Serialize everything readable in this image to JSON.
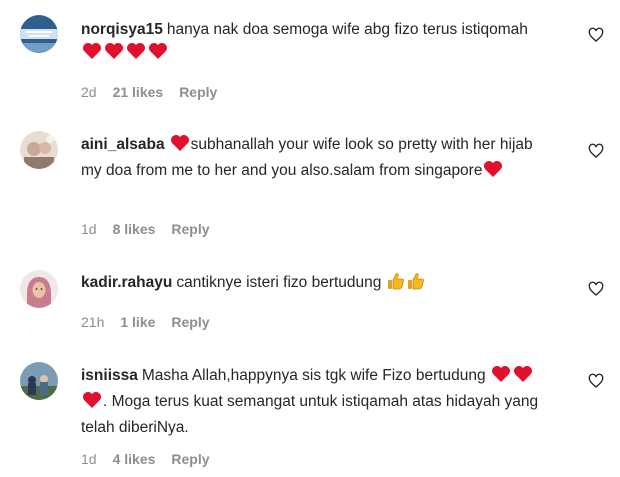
{
  "comments": [
    {
      "username": "norqisya15",
      "text_parts": [
        "hanya nak doa semoga wife abg fizo terus istiqomah "
      ],
      "emoji_after": "hearts-4",
      "time": "2d",
      "likes": "21 likes",
      "reply": "Reply"
    },
    {
      "username": "aini_alsaba",
      "text_parts": [
        "subhanallah your wife look so pretty with her hijab my doa from me to her and you also.salam from singapore"
      ],
      "time": "1d",
      "likes": "8 likes",
      "reply": "Reply"
    },
    {
      "username": "kadir.rahayu",
      "text_parts": [
        "cantiknye isteri fizo bertudung "
      ],
      "time": "21h",
      "likes": "1 like",
      "reply": "Reply"
    },
    {
      "username": "isniissa",
      "text_parts": [
        "Masha Allah,happynya sis tgk wife Fizo bertudung ",
        ". Moga terus kuat semangat untuk istiqamah atas hidayah yang telah diberiNya."
      ],
      "time": "1d",
      "likes": "4 likes",
      "reply": "Reply"
    }
  ],
  "colors": {
    "text": "#262626",
    "meta": "#8e8e8e",
    "heart_red": "#e0102f",
    "thumb_yellow": "#f5b823"
  },
  "icons": [
    "like-heart-outline-icon",
    "red-heart-emoji-icon",
    "thumbs-up-emoji-icon"
  ]
}
